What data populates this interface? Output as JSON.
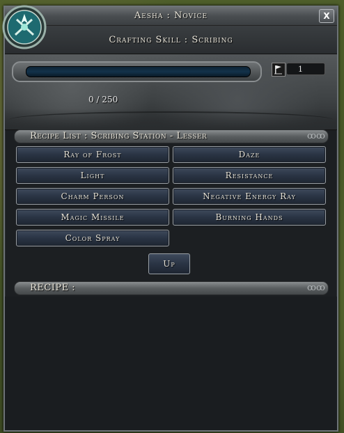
{
  "window": {
    "title": "Aesha : Novice",
    "close_label": "X",
    "subtitle": "Crafting Skill : Scribing"
  },
  "skill": {
    "progress_text": "0 / 250",
    "progress_fraction": 0,
    "level": "1"
  },
  "recipe_list": {
    "header": "Recipe List : Scribing Station - Lesser",
    "items": [
      "Ray of Frost",
      "Daze",
      "Light",
      "Resistance",
      "Charm Person",
      "Negative Energy Ray",
      "Magic Missile",
      "Burning Hands",
      "Color Spray"
    ],
    "up_label": "Up"
  },
  "recipe": {
    "header": "RECIPE :"
  },
  "icons": {
    "emblem": "crafting-emblem-icon",
    "flag": "flag-icon",
    "ornament": "scroll-ornament-icon"
  },
  "colors": {
    "window_bg": "#1c1f22",
    "button_bg": "#2a3444",
    "text": "#e8e4d8"
  }
}
